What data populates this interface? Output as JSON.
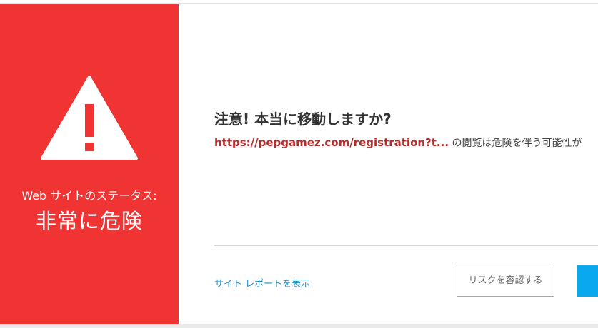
{
  "status_panel": {
    "label": "Web サイトのステータス:",
    "value": "非常に危険",
    "icon": "warning-triangle-icon",
    "color": "#f03333"
  },
  "main": {
    "title": "注意! 本当に移動しますか?",
    "url": "https://pepgamez.com/registration?t...",
    "message_suffix": " の閲覧は危険を伴う可能性が"
  },
  "footer": {
    "report_link": "サイト レポートを表示",
    "risk_button": "リスクを容認する",
    "primary_button_color": "#0aa8ee"
  }
}
